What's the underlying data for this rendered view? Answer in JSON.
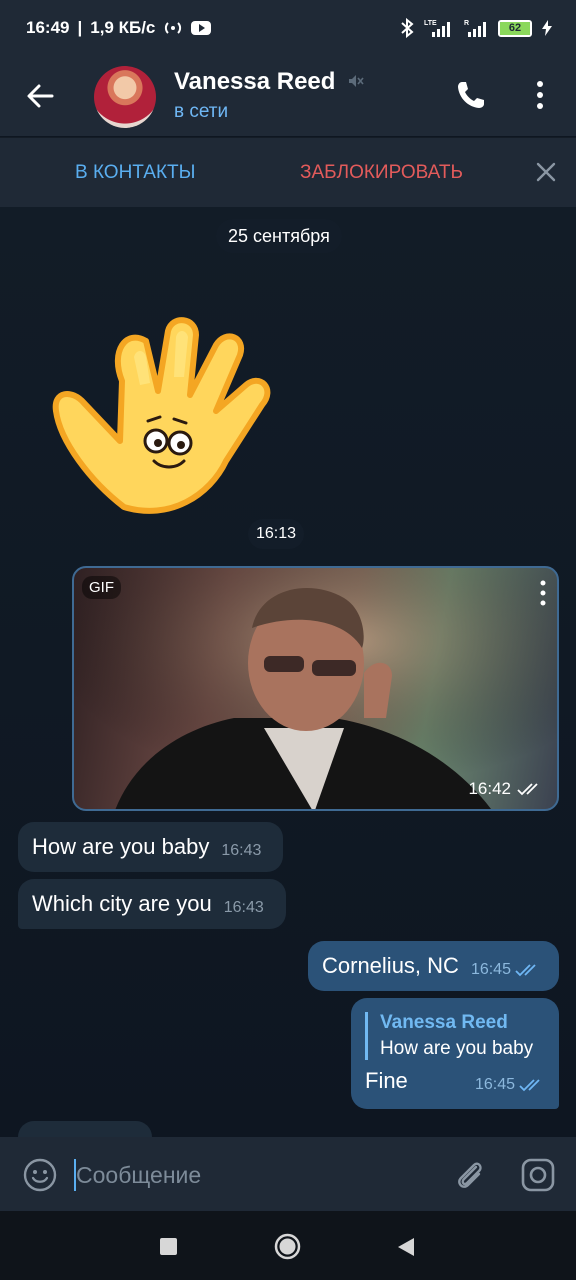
{
  "status_bar": {
    "time": "16:49",
    "network_speed": "1,9 КБ/с",
    "battery_level": "62",
    "icons": [
      "hotspot-icon",
      "youtube-icon",
      "bluetooth-icon",
      "lte-signal-icon",
      "roaming-signal-icon",
      "battery-icon",
      "charging-icon"
    ]
  },
  "header": {
    "contact_name": "Vanessa Reed",
    "contact_status": "в сети"
  },
  "action_bar": {
    "add_contact_label": "В КОНТАКТЫ",
    "block_label": "ЗАБЛОКИРОВАТЬ"
  },
  "chat": {
    "date_label": "25 сентября",
    "sticker_time": "16:13",
    "gif": {
      "badge": "GIF",
      "time": "16:42"
    },
    "messages_in": [
      {
        "text": "How are you baby",
        "time": "16:43"
      },
      {
        "text": "Which city are you",
        "time": "16:43"
      }
    ],
    "messages_out": [
      {
        "text": "Cornelius, NC",
        "time": "16:45"
      },
      {
        "reply_name": "Vanessa Reed",
        "reply_text": "How are you baby",
        "text": "Fine",
        "time": "16:45"
      }
    ]
  },
  "input": {
    "placeholder": "Сообщение"
  },
  "colors": {
    "accent": "#5aaef0",
    "danger": "#e35b5b",
    "incoming_bubble": "#1e2c3a",
    "outgoing_bubble": "#2b5278",
    "header_bg": "#1f2936",
    "chat_bg": "#0e1621"
  }
}
